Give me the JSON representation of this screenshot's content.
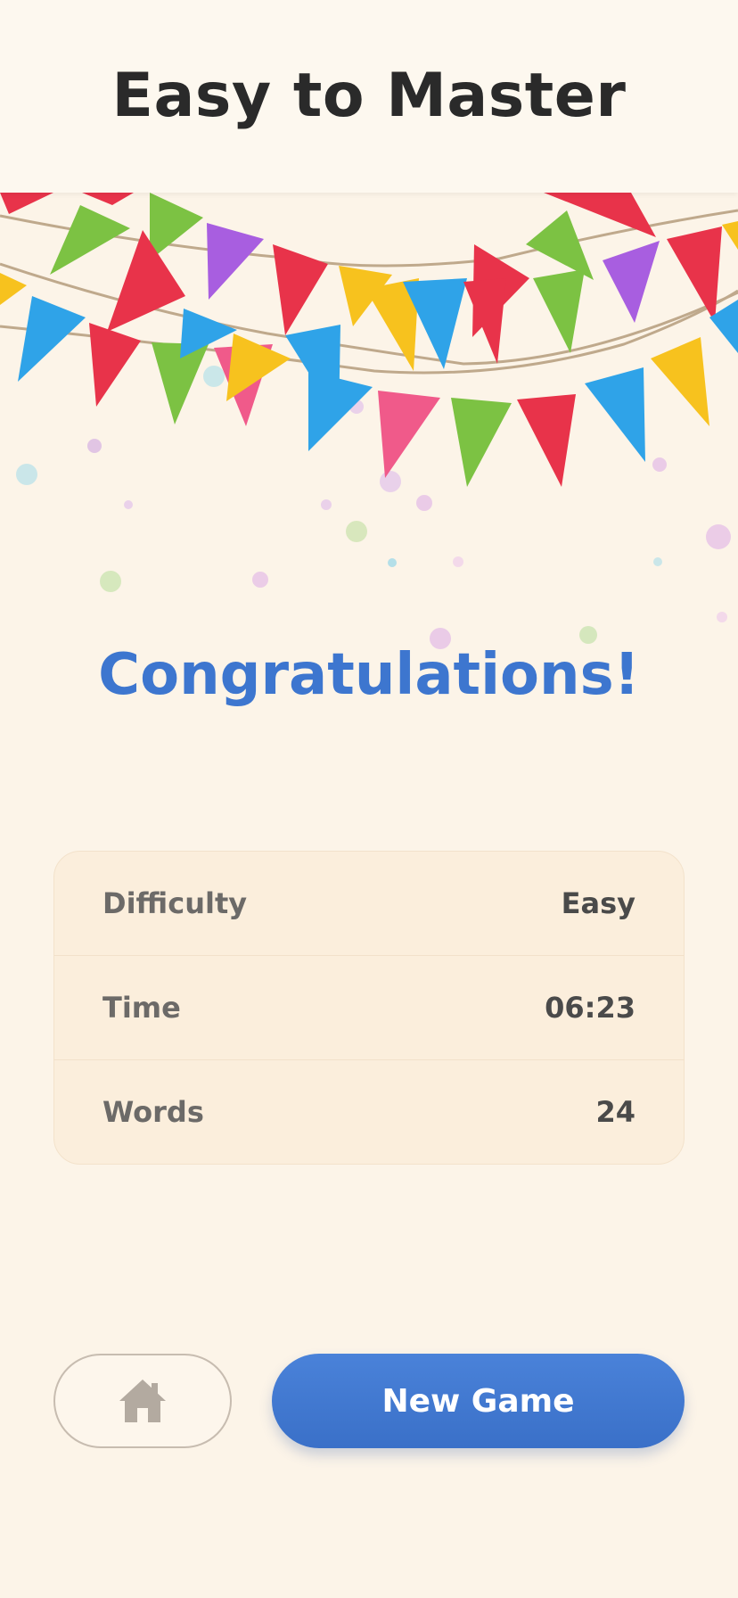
{
  "header": {
    "title": "Easy to Master"
  },
  "celebration": {
    "heading": "Congratulations!",
    "heading_color": "#3d76cf"
  },
  "stats": [
    {
      "label": "Difficulty",
      "value": "Easy"
    },
    {
      "label": "Time",
      "value": "06:23"
    },
    {
      "label": "Words",
      "value": "24"
    }
  ],
  "actions": {
    "home_icon": "home-icon",
    "new_game_label": "New Game",
    "new_game_color": "#3d76cf"
  },
  "decoration": {
    "banner_colors": [
      "#e8334a",
      "#7cc243",
      "#a85ee0",
      "#2fa3e8",
      "#f7c21e",
      "#f05a8a"
    ]
  }
}
